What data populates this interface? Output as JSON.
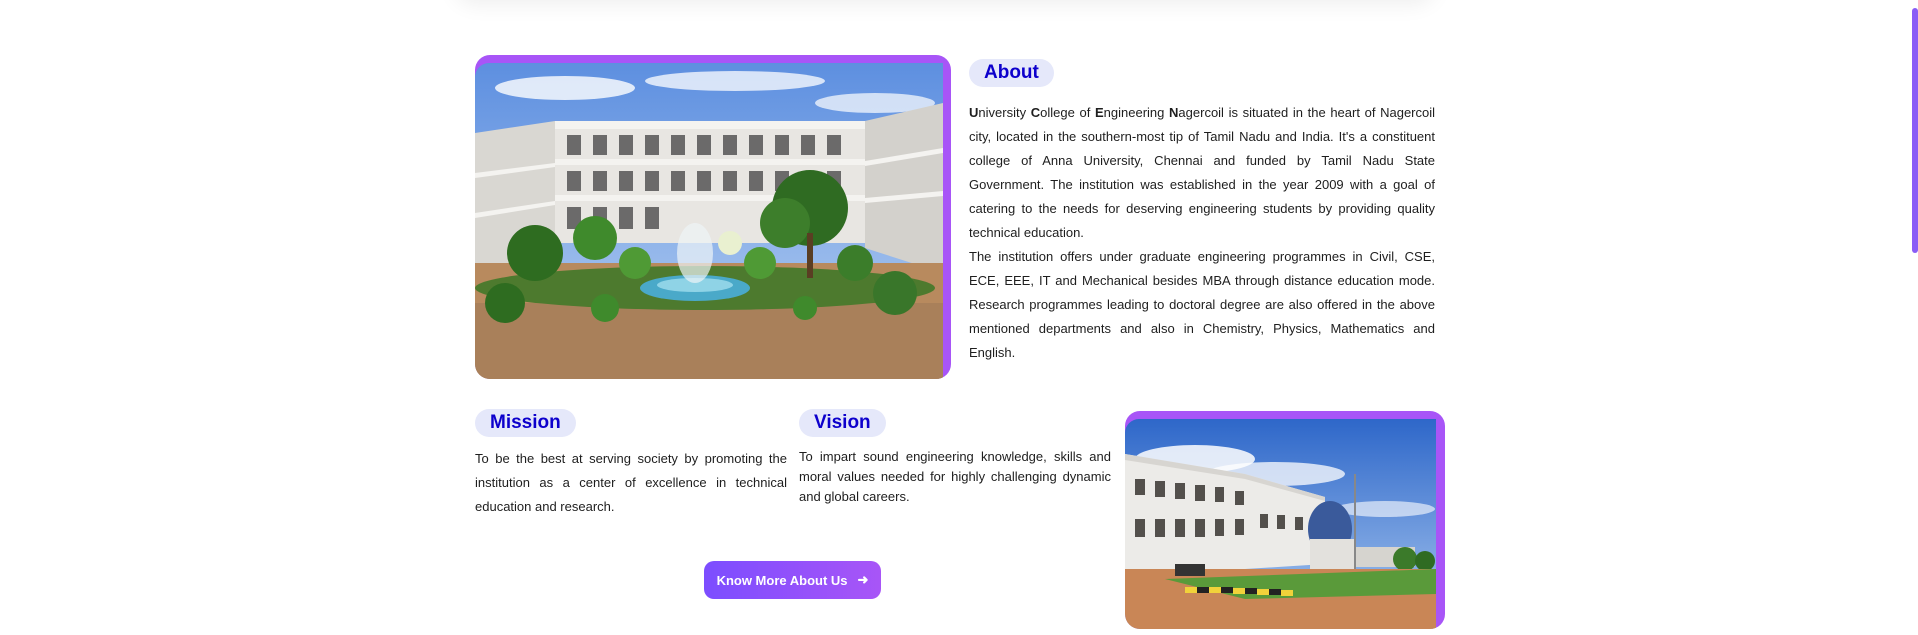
{
  "about": {
    "heading": "About",
    "paragraph1_caps": [
      "U",
      "C",
      "E",
      "N"
    ],
    "paragraph1_parts": [
      "niversity ",
      "ollege of ",
      "ngineering ",
      "agercoil is situated in the heart of Nagercoil city, located in the southern-most tip of Tamil Nadu and India. It's a constituent college of Anna University, Chennai and funded by Tamil Nadu State Government. The institution was established in the year 2009 with a goal of catering to the needs for deserving engineering students by providing quality technical education."
    ],
    "paragraph2": "The institution offers under graduate engineering programmes in Civil, CSE, ECE, EEE, IT and Mechanical besides MBA through distance education mode. Research programmes leading to doctoral degree are also offered in the above mentioned departments and also in Chemistry, Physics, Mathematics and English."
  },
  "mission": {
    "heading": "Mission",
    "text": "To be the best at serving society by promoting the institution as a center of excellence in technical education and research."
  },
  "vision": {
    "heading": "Vision",
    "text": "To impart sound engineering knowledge, skills and moral values needed for highly challenging dynamic and global careers."
  },
  "cta": {
    "label": "Know More About Us",
    "icon": "arrow-right-icon"
  },
  "colors": {
    "accent": "#a855f7",
    "heading_text": "#0d00cc",
    "pill_bg": "#e5e8fa"
  }
}
